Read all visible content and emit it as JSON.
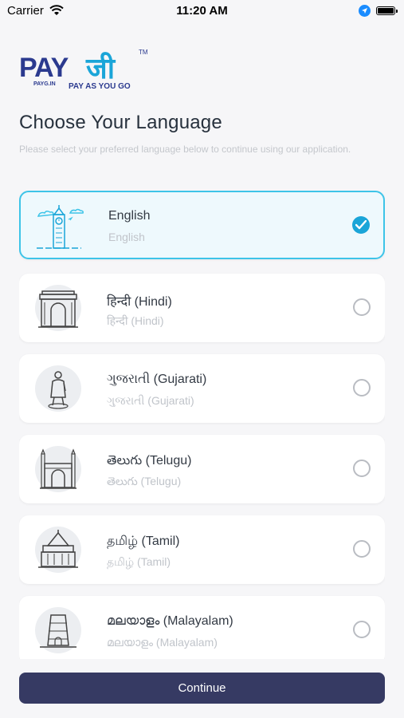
{
  "status_bar": {
    "carrier": "Carrier",
    "time": "11:20 AM"
  },
  "logo": {
    "brand_text": "PAY जी",
    "tm": "TM",
    "domain": "PAYG.IN",
    "tagline": "PAY AS YOU GO"
  },
  "page": {
    "title": "Choose Your Language",
    "subtitle": "Please select your preferred language below to continue using our application."
  },
  "languages": [
    {
      "name": "English",
      "native": "English",
      "selected": true,
      "icon": "big-ben-icon"
    },
    {
      "name": "हिन्दी (Hindi)",
      "native": "हिन्दी (Hindi)",
      "selected": false,
      "icon": "india-gate-icon"
    },
    {
      "name": "ગુજરાતી (Gujarati)",
      "native": "ગુજરાતી (Gujarati)",
      "selected": false,
      "icon": "statue-of-unity-icon"
    },
    {
      "name": "తెలుగు (Telugu)",
      "native": "తెలుగు (Telugu)",
      "selected": false,
      "icon": "charminar-icon"
    },
    {
      "name": "தமிழ் (Tamil)",
      "native": "தமிழ் (Tamil)",
      "selected": false,
      "icon": "temple-icon"
    },
    {
      "name": "മലയാളം (Malayalam)",
      "native": "മലയാളം (Malayalam)",
      "selected": false,
      "icon": "gopuram-icon"
    }
  ],
  "continue_label": "Continue",
  "colors": {
    "accent": "#1aa5d8",
    "button": "#363a63",
    "selected_border": "#3dc4e8",
    "brand_blue": "#2b3a8f"
  }
}
